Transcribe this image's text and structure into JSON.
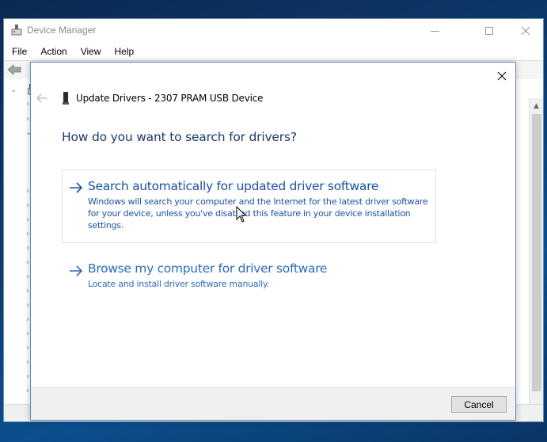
{
  "device_manager": {
    "title": "Device Manager",
    "window_controls": {
      "minimize": "minimize",
      "maximize": "maximize",
      "close": "close"
    },
    "menu": [
      {
        "label": "File"
      },
      {
        "label": "Action"
      },
      {
        "label": "View"
      },
      {
        "label": "Help"
      }
    ]
  },
  "dialog": {
    "title": "Update Drivers - 2307 PRAM USB Device",
    "heading": "How do you want to search for drivers?",
    "options": [
      {
        "title": "Search automatically for updated driver software",
        "description": "Windows will search your computer and the Internet for the latest driver software for your device, unless you've disabled this feature in your device installation settings."
      },
      {
        "title": "Browse my computer for driver software",
        "description": "Locate and install driver software manually."
      }
    ],
    "cancel_label": "Cancel"
  },
  "colors": {
    "accent_link": "#1d50a3",
    "heading": "#1c3a6e",
    "dialog_border": "#5b8cc0"
  }
}
